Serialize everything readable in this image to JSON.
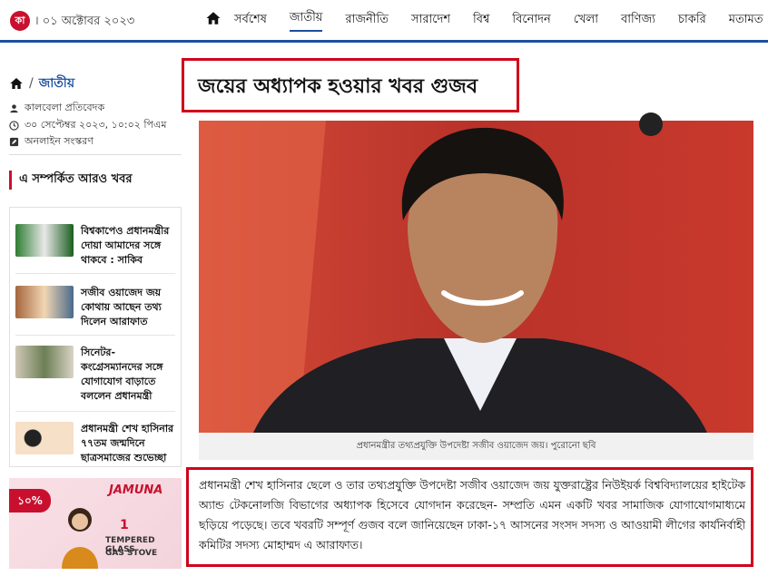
{
  "header": {
    "logo": "কা",
    "date": "। ০১ অক্টোবর ২০২৩",
    "nav": [
      "সর্বশেষ",
      "জাতীয়",
      "রাজনীতি",
      "সারাদেশ",
      "বিশ্ব",
      "বিনোদন",
      "খেলা",
      "বাণিজ্য",
      "চাকরি",
      "মতামত"
    ],
    "active_nav": "জাতীয়"
  },
  "breadcrumb": {
    "sep": "/",
    "current": "জাতীয়"
  },
  "meta": {
    "author": "কালবেলা প্রতিবেদক",
    "time": "৩০ সেপ্টেম্বর ২০২৩, ১০:০২ পিএম",
    "edition": "অনলাইন সংস্করণ"
  },
  "related": {
    "title": "এ সম্পর্কিত আরও খবর",
    "items": [
      {
        "text": "বিশ্বকাপেও প্রধানমন্ত্রীর দোয়া আমাদের সঙ্গে থাকবে : সাকিব"
      },
      {
        "text": "সজীব ওয়াজেদ জয় কোথায় আছেন তথ্য দিলেন আরাফাত"
      },
      {
        "text": "সিনেটর-কংগ্রেসম্যানদের সঙ্গে যোগাযোগ বাড়াতে বললেন প্রধানমন্ত্রী"
      },
      {
        "text": "প্রধানমন্ত্রী শেখ হাসিনার ৭৭তম জন্মদিনে ছাত্রসমাজের শুভেচ্ছা"
      }
    ]
  },
  "ad": {
    "badge": "১০%",
    "brand": "JAMUNA",
    "line1": "1",
    "line2": "TEMPERED GLASS",
    "line3": "GAS STOVE"
  },
  "article": {
    "headline": "জয়ের অধ্যাপক হওয়ার খবর গুজব",
    "caption": "প্রধানমন্ত্রীর তথ্যপ্রযুক্তি উপদেষ্টা সজীব ওয়াজেদ জয়। পুরোনো ছবি",
    "body": "প্রধানমন্ত্রী শেখ হাসিনার ছেলে ও তার তথ্যপ্রযুক্তি উপদেষ্টা সজীব ওয়াজেদ জয় যুক্তরাষ্ট্রের নিউইয়র্ক বিশ্ববিদ্যালয়ের হাইটেক অ্যান্ড টেকনোলজি বিভাগের অধ্যাপক হিসেবে যোগদান করেছেন- সম্প্রতি এমন একটি খবর সামাজিক যোগাযোগমাধ্যমে ছড়িয়ে পড়েছে। তবে খবরটি সম্পূর্ণ গুজব বলে জানিয়েছেন ঢাকা-১৭ আসনের সংসদ সদস্য ও আওয়ামী লীগের কার্যনির্বাহী কমিটির সদস্য মোহাম্মদ এ আরাফাত।"
  },
  "colors": {
    "accent": "#1b4fa0",
    "highlight": "#d0021b",
    "brand_red": "#c8102e"
  }
}
